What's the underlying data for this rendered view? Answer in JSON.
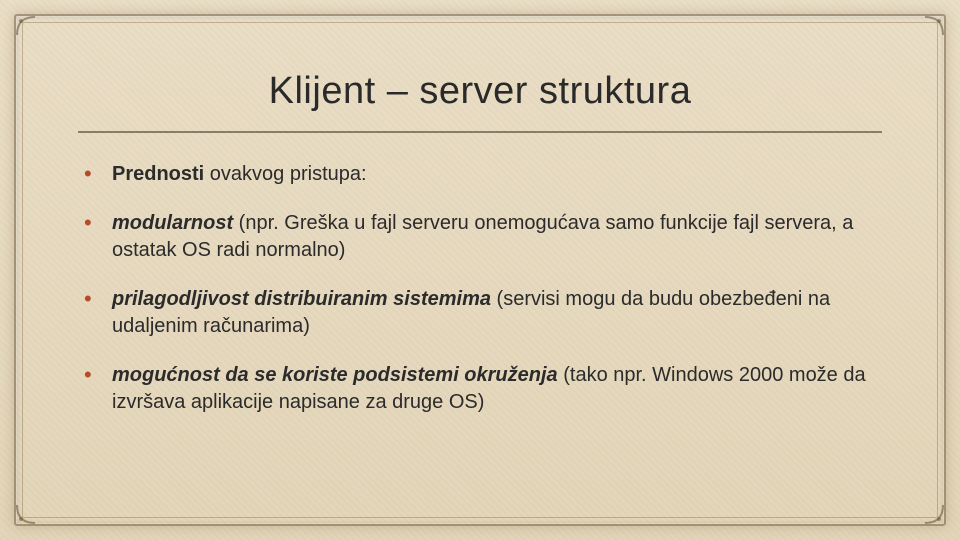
{
  "slide": {
    "title": "Klijent – server struktura",
    "bullets": [
      {
        "prefix_bold": "Prednosti",
        "prefix_bolditalic": "",
        "rest": " ovakvog pristupa:"
      },
      {
        "prefix_bold": "",
        "prefix_bolditalic": "modularnost",
        "rest": " (npr. Greška u fajl serveru onemogućava samo funkcije fajl servera, a ostatak OS radi normalno)"
      },
      {
        "prefix_bold": "",
        "prefix_bolditalic": "prilagodljivost distribuiranim sistemima",
        "rest": " (servisi mogu da budu obezbeđeni na udaljenim računarima)"
      },
      {
        "prefix_bold": "",
        "prefix_bolditalic": "mogućnost da se koriste podsistemi okruženja",
        "rest": " (tako npr. Windows 2000 može da izvršava aplikacije napisane za druge OS)"
      }
    ]
  }
}
